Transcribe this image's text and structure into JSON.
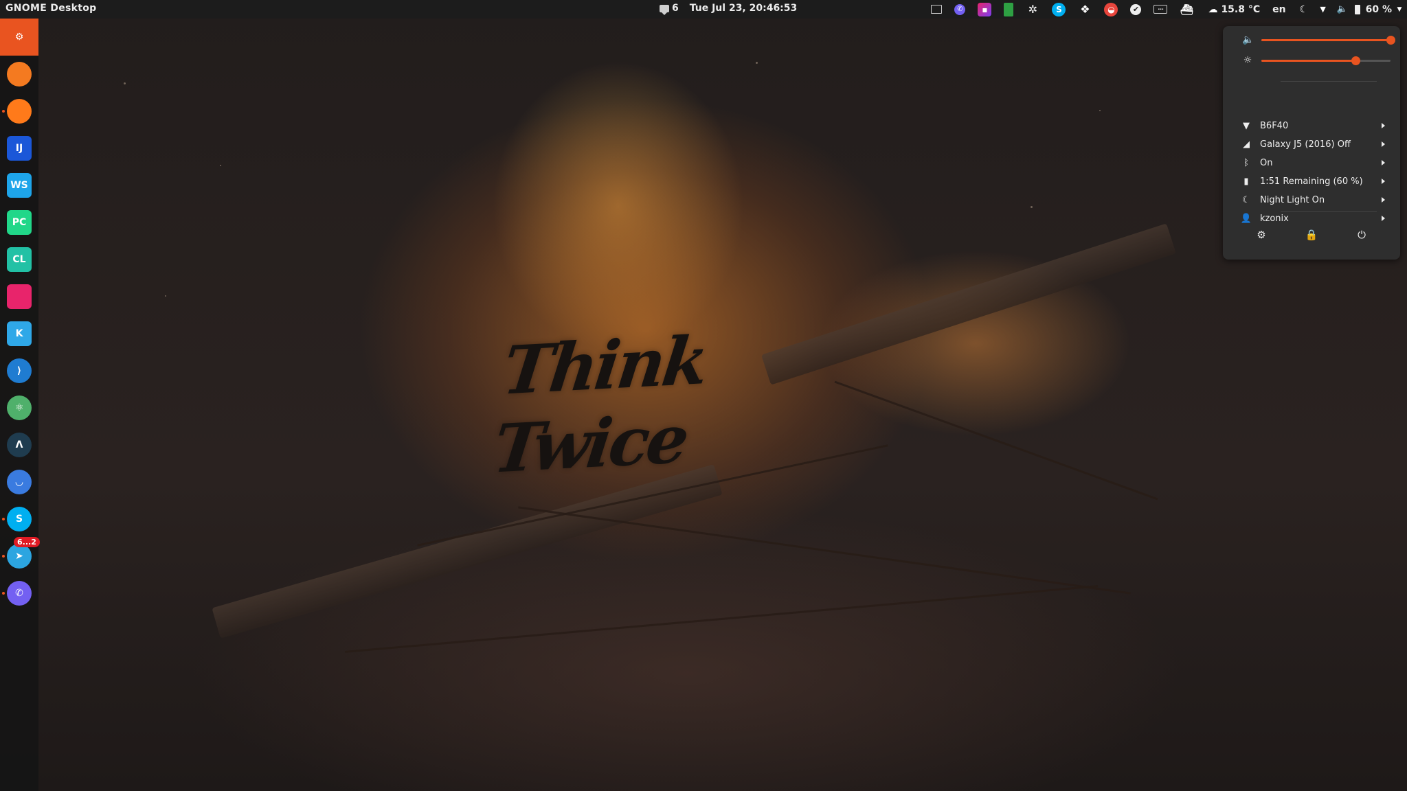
{
  "topbar": {
    "activities_label": "GNOME Desktop",
    "notification_count": "6",
    "datetime": "Tue Jul 23, 20:46:53",
    "weather": "15.8 °C",
    "keyboard_layout": "en",
    "battery_percent": "60 %"
  },
  "wallpaper": {
    "title": "Think Twice"
  },
  "dock": {
    "items": [
      {
        "name": "ubuntu-logo-icon",
        "color": "#e95420",
        "glyph": "⚙",
        "running": false
      },
      {
        "name": "orange-app-icon",
        "color": "#f47a20",
        "glyph": "",
        "running": false
      },
      {
        "name": "firefox-icon",
        "color": "#ff7a1a",
        "glyph": "",
        "running": true
      },
      {
        "name": "intellij-idea-icon",
        "color": "#1b57d8",
        "glyph": "IJ",
        "running": false
      },
      {
        "name": "webstorm-icon",
        "color": "#1ea5ea",
        "glyph": "WS",
        "running": false
      },
      {
        "name": "pycharm-icon",
        "color": "#21d789",
        "glyph": "PC",
        "running": false
      },
      {
        "name": "clion-icon",
        "color": "#22c1a5",
        "glyph": "CL",
        "running": false
      },
      {
        "name": "jetbrains-toolbox-icon",
        "color": "#e8246b",
        "glyph": "",
        "running": false
      },
      {
        "name": "kotlin-icon",
        "color": "#2fa8e8",
        "glyph": "K",
        "running": false
      },
      {
        "name": "vscode-icon",
        "color": "#1f7cd1",
        "glyph": "⟩",
        "running": false
      },
      {
        "name": "atom-icon",
        "color": "#4fb06b",
        "glyph": "⚛",
        "running": false
      },
      {
        "name": "android-studio-icon",
        "color": "#1f3c4f",
        "glyph": "Λ",
        "running": false
      },
      {
        "name": "shopping-bag-icon",
        "color": "#3a7be0",
        "glyph": "◡",
        "running": false
      },
      {
        "name": "skype-icon",
        "color": "#00aff0",
        "glyph": "S",
        "running": true
      },
      {
        "name": "telegram-icon",
        "color": "#2ca5e0",
        "glyph": "➤",
        "running": true,
        "badge": "6...2"
      },
      {
        "name": "viber-icon",
        "color": "#7360f2",
        "glyph": "✆",
        "running": true
      }
    ]
  },
  "system_menu": {
    "volume_level": 1.0,
    "brightness_level": 0.73,
    "rows": [
      {
        "icon": "wifi-icon",
        "glyph": "▼",
        "label": "B6F40"
      },
      {
        "icon": "mobile-signal-icon",
        "glyph": "◢",
        "label": "Galaxy J5 (2016) Off"
      },
      {
        "icon": "bluetooth-icon",
        "glyph": "ᛒ",
        "label": "On"
      },
      {
        "icon": "battery-icon",
        "glyph": "▮",
        "label": "1:51 Remaining (60 %)"
      },
      {
        "icon": "night-light-icon",
        "glyph": "☾",
        "label": "Night Light On"
      },
      {
        "icon": "user-icon",
        "glyph": "👤",
        "label": "kzonix"
      }
    ]
  },
  "colors": {
    "accent": "#e95420",
    "topbar_bg": "#1c1c1c",
    "menu_bg": "#2e2e2e"
  }
}
